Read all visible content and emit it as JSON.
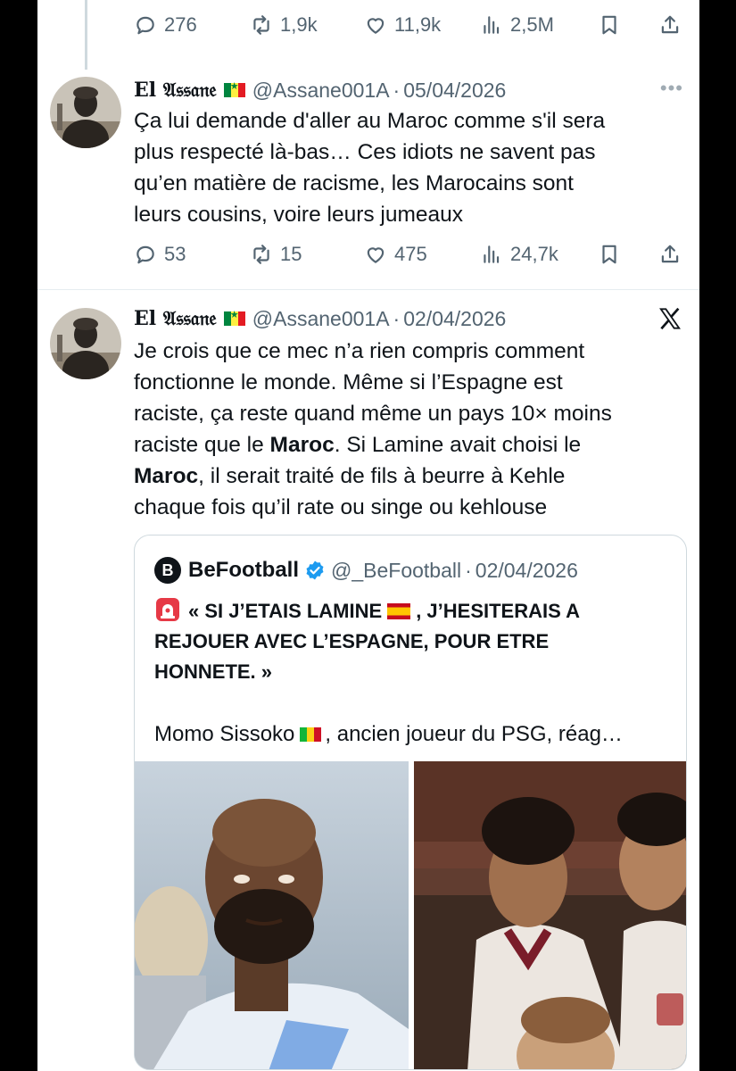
{
  "tweets": [
    {
      "actions": {
        "replies": "276",
        "reposts": "1,9k",
        "likes": "11,9k",
        "views": "2,5M"
      }
    },
    {
      "name": "El 𝔄𝔰𝔰𝔞𝔫𝔢",
      "handle": "@Assane001A",
      "separator": "·",
      "date": "05/04/2026",
      "more": "•••",
      "lines": [
        "Ça lui demande d'aller au Maroc comme s'il sera",
        "plus respecté là-bas… Ces idiots ne savent pas",
        "qu’en matière de racisme, les Marocains sont",
        "leurs cousins, voire leurs jumeaux"
      ],
      "actions": {
        "replies": "53",
        "reposts": "15",
        "likes": "475",
        "views": "24,7k"
      }
    },
    {
      "name": "El 𝔄𝔰𝔰𝔞𝔫𝔢",
      "handle": "@Assane001A",
      "separator": "·",
      "date": "02/04/2026",
      "text": {
        "l1": "Je crois que ce mec n’a rien compris comment",
        "l2": "fonctionne le monde. Même si l’Espagne est",
        "l3": "raciste, ça reste quand même un pays 10× moins",
        "l4a": "raciste que le ",
        "l4b": "Maroc",
        "l4c": ". Si Lamine avait choisi le",
        "l5a": "Maroc",
        "l5b": ", il serait traité de fils à beurre à Kehle",
        "l6": "chaque fois qu’il rate ou singe ou kehlouse"
      }
    }
  ],
  "quote": {
    "logo_letter": "B",
    "name": "BeFootball",
    "handle": "@_BeFootball",
    "separator": "·",
    "date": "02/04/2026",
    "bold_1a": "« SI J’ETAIS LAMINE",
    "bold_1b": ", J’HESITERAIS A",
    "bold_2": "REJOUER AVEC L’ESPAGNE, POUR ETRE",
    "bold_3": "HONNETE. »",
    "body_a": "Momo Sissoko",
    "body_b": ", ancien joueur du PSG, réag…"
  },
  "icons": [
    "reply-icon",
    "repost-icon",
    "like-icon",
    "views-icon",
    "bookmark-icon",
    "share-icon",
    "x-logo-icon",
    "verified-icon",
    "siren-emoji-icon"
  ],
  "colors": {
    "icon_gray": "#536471",
    "verified_blue": "#1d9bf0",
    "text": "#0f1419",
    "border": "#cfd9de"
  }
}
